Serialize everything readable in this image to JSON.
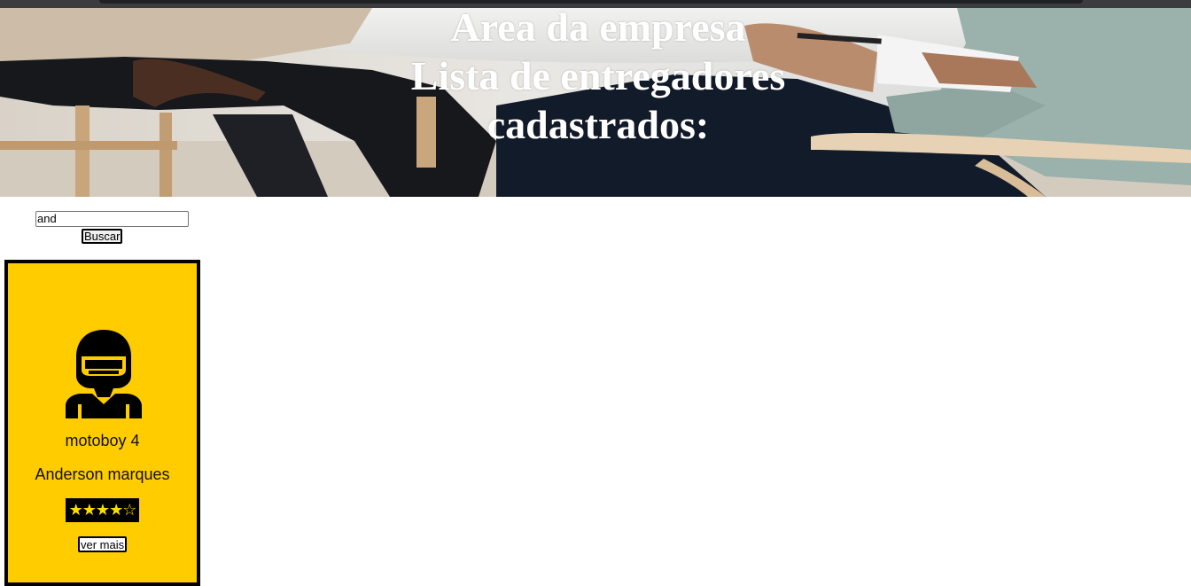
{
  "header": {
    "title_line1": "Area da empresa",
    "title_line2": "Lista de entregadores",
    "title_line3": "cadastrados:"
  },
  "search": {
    "value": "and",
    "button_label": "Buscar"
  },
  "couriers": [
    {
      "title": "motoboy 4",
      "name": "Anderson marques",
      "rating": 4,
      "rating_max": 5,
      "stars_text": "★★★★☆",
      "more_label": "ver mais",
      "avatar_icon": "motorcycle-helmet-courier-icon"
    }
  ],
  "colors": {
    "card_background": "#ffcc00",
    "card_border": "#000000",
    "header_text": "#ffffff",
    "rating_star": "#ffdd00"
  }
}
